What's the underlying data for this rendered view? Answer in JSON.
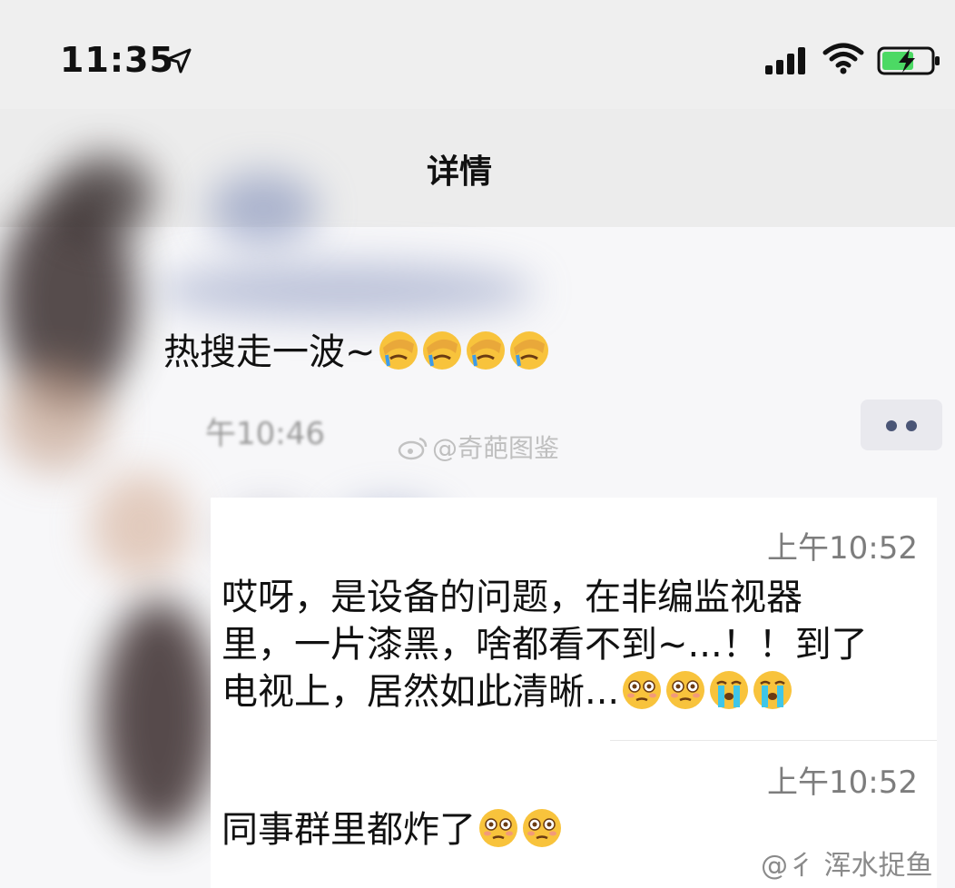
{
  "status_bar": {
    "time": "11:35"
  },
  "nav": {
    "title_visible": "详情"
  },
  "messages": {
    "first_text": "热搜走一波~",
    "first_time_partial": "午10:46",
    "second_time": "上午10:52",
    "second_line1": "哎呀，是设备的问题，在非编监视器",
    "second_line2": "里，一片漆黑，啥都看不到~...！！到了",
    "second_line3": "电视上，居然如此清晰...",
    "third_time": "上午10:52",
    "third_text": "同事群里都炸了"
  },
  "watermarks": {
    "center": "@奇葩图鉴",
    "bottom": "@彳 浑水捉鱼"
  },
  "icons": {
    "location": "location-arrow-icon",
    "signal": "cellular-signal-icon",
    "wifi": "wifi-icon",
    "battery": "battery-charging-icon",
    "more": "more-dots-icon",
    "emoji_facepalm": "facepalm-emoji-icon",
    "emoji_flushed": "flushed-emoji-icon",
    "emoji_crying": "loudly-crying-emoji-icon"
  },
  "colors": {
    "battery": "#4cd964",
    "more_dots": "#4a5576",
    "time_text": "#7d7d7d"
  }
}
